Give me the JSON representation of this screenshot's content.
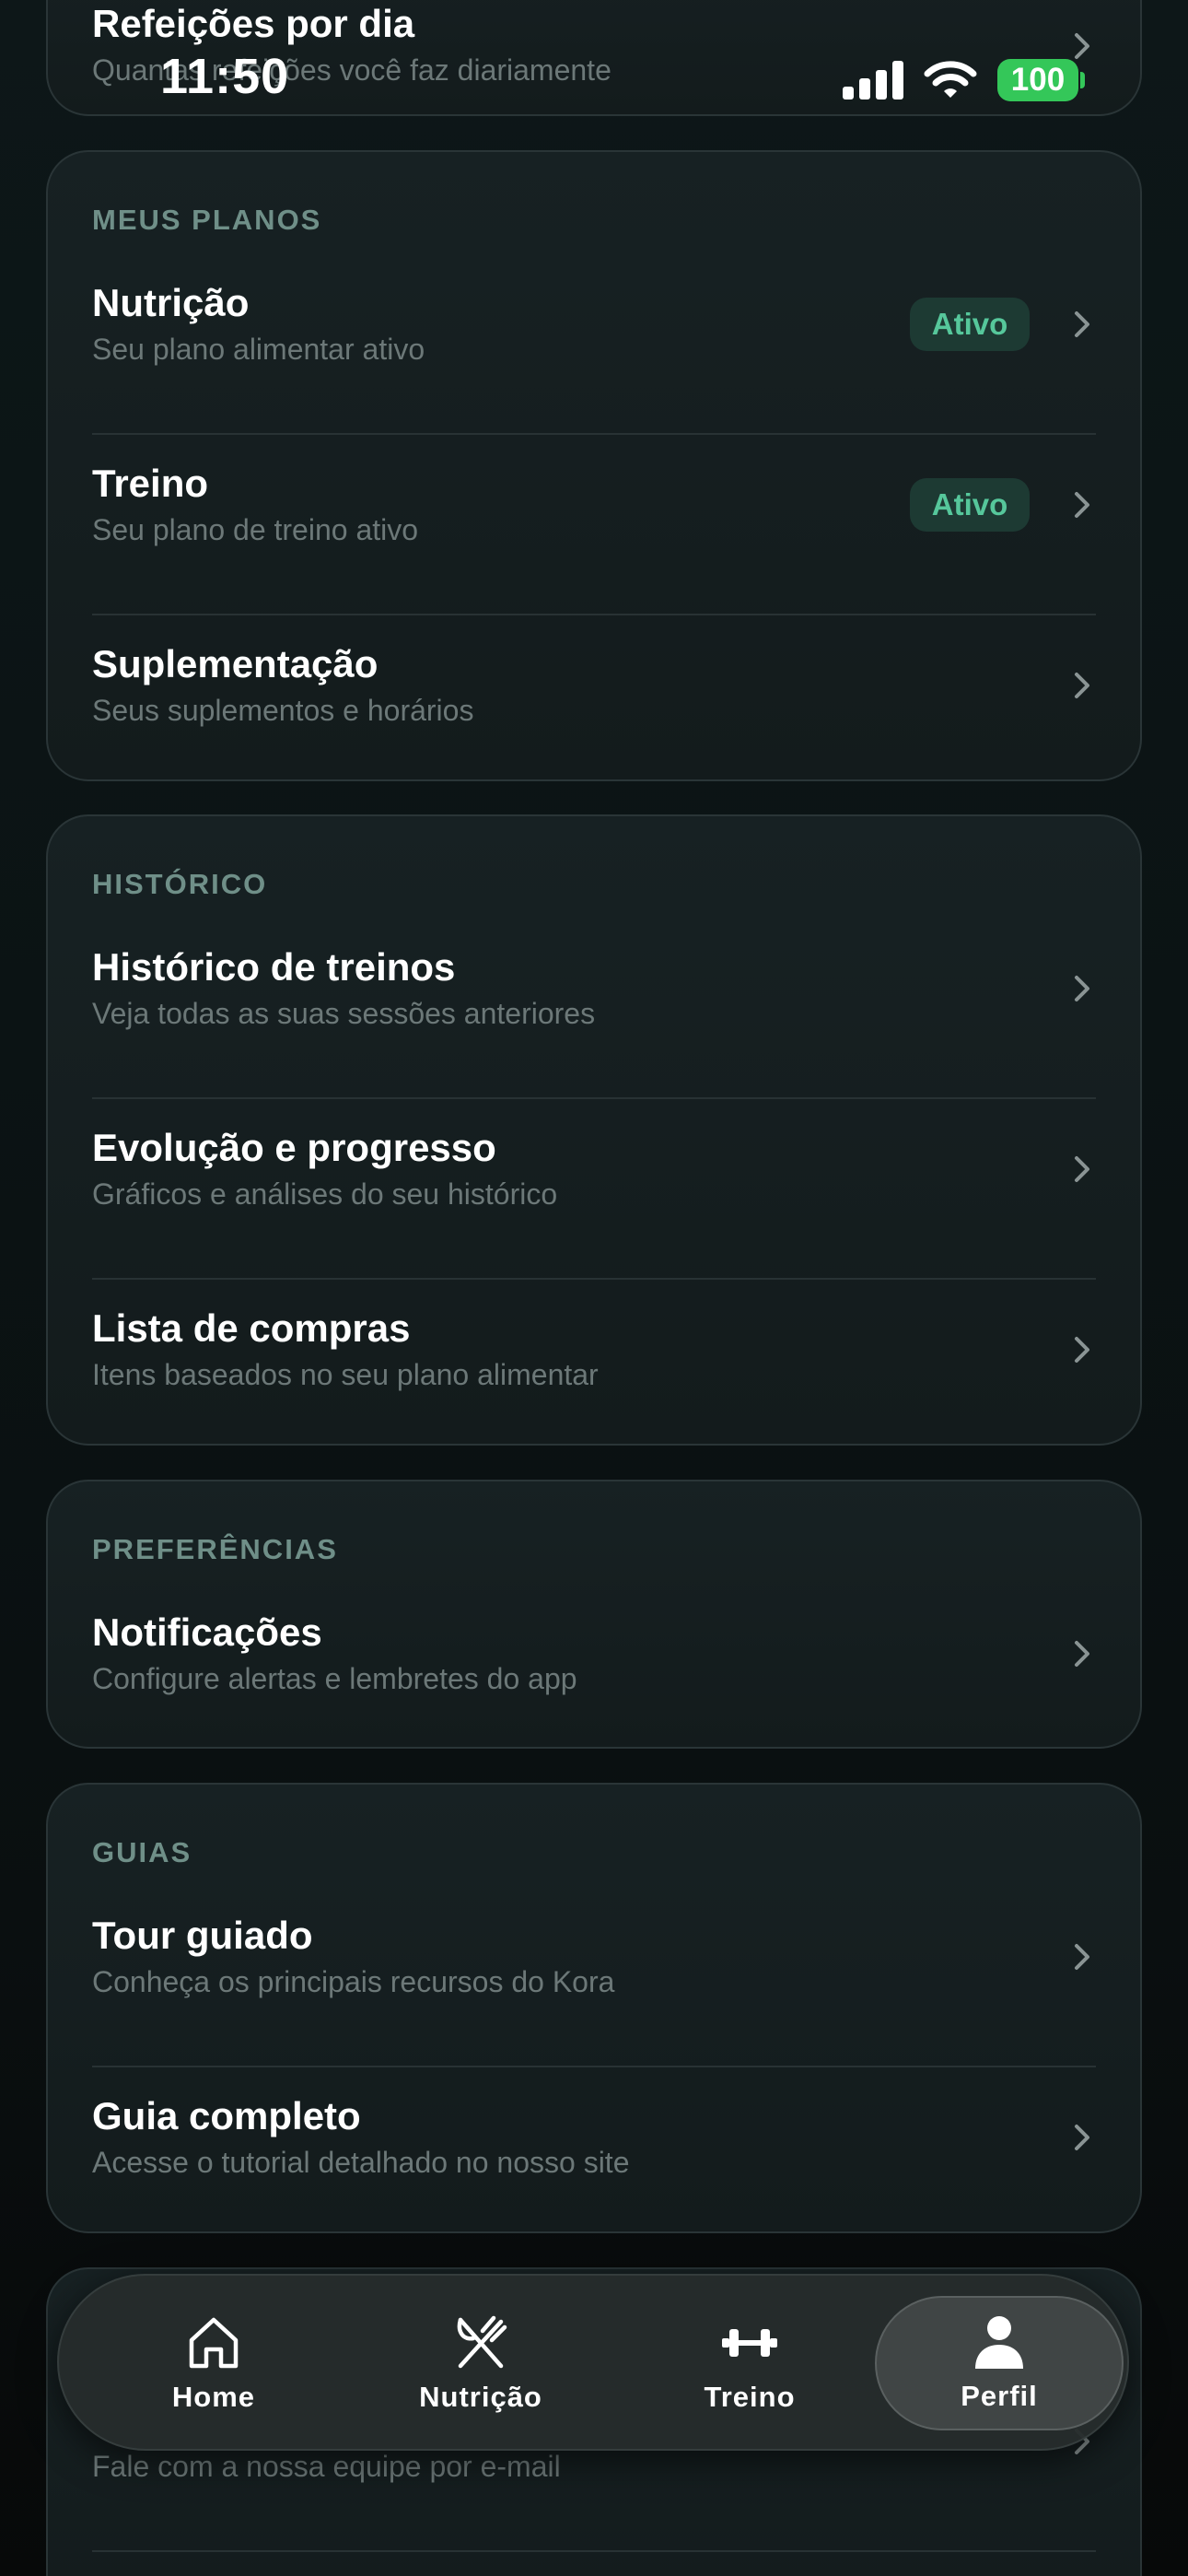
{
  "status_bar": {
    "time": "11:50",
    "battery": "100"
  },
  "top_partial": {
    "title": "Refeições por dia",
    "subtitle": "Quantas refeições você faz diariamente"
  },
  "sections": [
    {
      "title": "MEUS PLANOS",
      "items": [
        {
          "title": "Nutrição",
          "subtitle": "Seu plano alimentar ativo",
          "badge": "Ativo"
        },
        {
          "title": "Treino",
          "subtitle": "Seu plano de treino ativo",
          "badge": "Ativo"
        },
        {
          "title": "Suplementação",
          "subtitle": "Seus suplementos e horários"
        }
      ]
    },
    {
      "title": "HISTÓRICO",
      "items": [
        {
          "title": "Histórico de treinos",
          "subtitle": "Veja todas as suas sessões anteriores"
        },
        {
          "title": "Evolução e progresso",
          "subtitle": "Gráficos e análises do seu histórico"
        },
        {
          "title": "Lista de compras",
          "subtitle": "Itens baseados no seu plano alimentar"
        }
      ]
    },
    {
      "title": "PREFERÊNCIAS",
      "items": [
        {
          "title": "Notificações",
          "subtitle": "Configure alertas e lembretes do app"
        }
      ]
    },
    {
      "title": "GUIAS",
      "items": [
        {
          "title": "Tour guiado",
          "subtitle": "Conheça os principais recursos do Kora"
        },
        {
          "title": "Guia completo",
          "subtitle": "Acesse o tutorial detalhado no nosso site"
        }
      ]
    }
  ],
  "bottom_partial": {
    "subtitle": "Fale com a nossa equipe por e-mail"
  },
  "tabbar": {
    "tabs": [
      {
        "label": "Home",
        "icon": "home-icon"
      },
      {
        "label": "Nutrição",
        "icon": "fork-knife-icon"
      },
      {
        "label": "Treino",
        "icon": "dumbbell-icon"
      },
      {
        "label": "Perfil",
        "icon": "person-icon",
        "active": true
      }
    ]
  },
  "colors": {
    "accent": "#56c79b",
    "badge_bg": "#1d3a33",
    "battery": "#34c759"
  }
}
